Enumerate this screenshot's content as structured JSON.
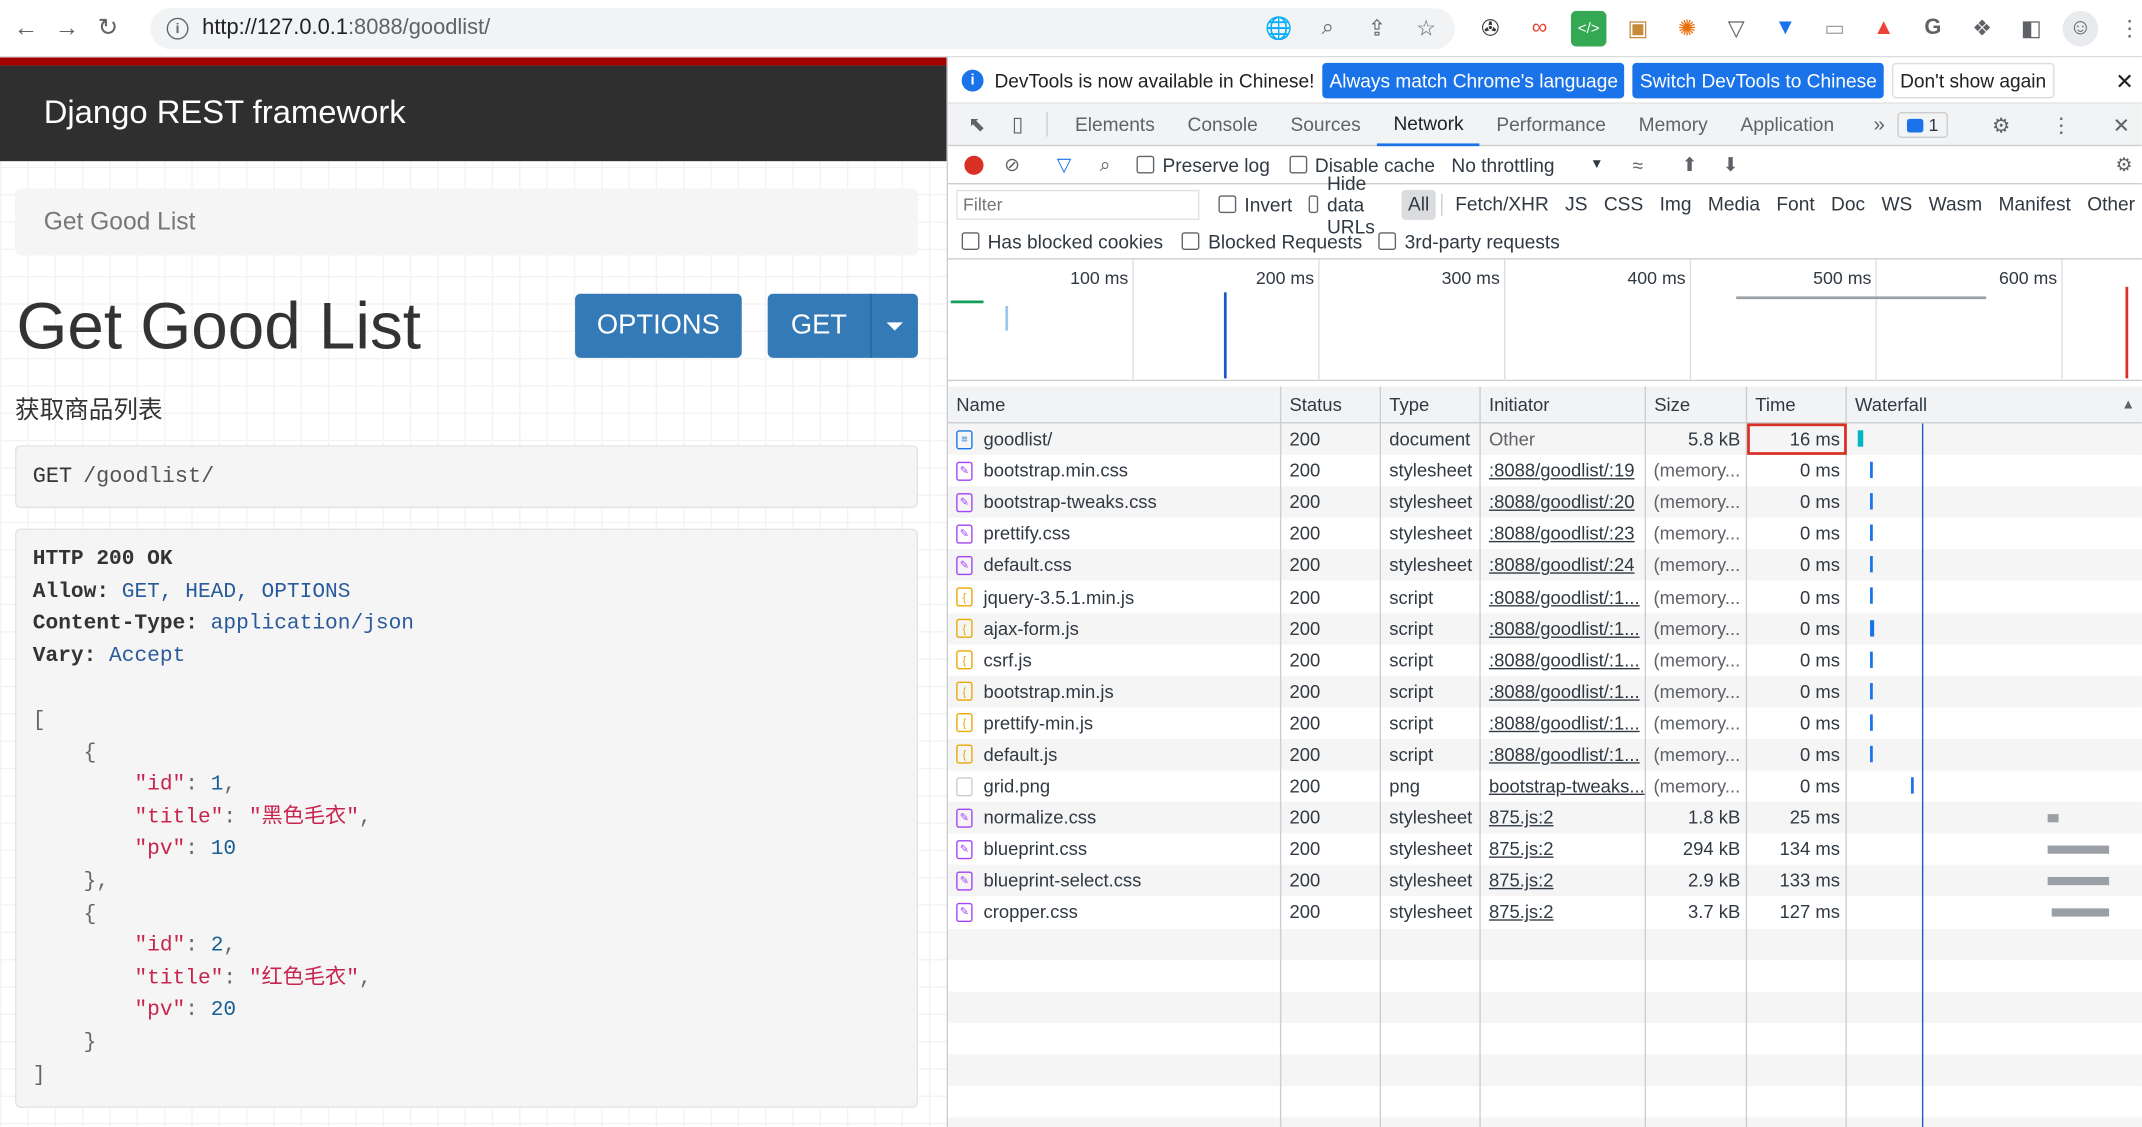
{
  "browser": {
    "url_host": "http://127.0.0.1",
    "url_rest": ":8088/goodlist/"
  },
  "page": {
    "brand": "Django REST framework",
    "breadcrumb": "Get Good List",
    "title": "Get Good List",
    "options_label": "OPTIONS",
    "get_label": "GET",
    "description": "获取商品列表",
    "request_method": "GET",
    "request_path": "/goodlist/",
    "response": {
      "status_line": "HTTP 200 OK",
      "allow_key": "Allow:",
      "allow_val": "GET, HEAD, OPTIONS",
      "ctype_key": "Content-Type:",
      "ctype_val": "application/json",
      "vary_key": "Vary:",
      "vary_val": "Accept",
      "items": [
        {
          "id": "1",
          "title": "\"黑色毛衣\"",
          "pv": "10"
        },
        {
          "id": "2",
          "title": "\"红色毛衣\"",
          "pv": "20"
        }
      ]
    }
  },
  "devtools": {
    "info_msg": "DevTools is now available in Chinese!",
    "btn_match": "Always match Chrome's language",
    "btn_switch": "Switch DevTools to Chinese",
    "btn_dont": "Don't show again",
    "tabs": [
      "Elements",
      "Console",
      "Sources",
      "Network",
      "Performance",
      "Memory",
      "Application"
    ],
    "badge_count": "1",
    "preserve_log": "Preserve log",
    "disable_cache": "Disable cache",
    "throttling": "No throttling",
    "filter_placeholder": "Filter",
    "invert": "Invert",
    "hide_data_urls": "Hide data URLs",
    "types": [
      "All",
      "Fetch/XHR",
      "JS",
      "CSS",
      "Img",
      "Media",
      "Font",
      "Doc",
      "WS",
      "Wasm",
      "Manifest",
      "Other"
    ],
    "blocked_cookies": "Has blocked cookies",
    "blocked_requests": "Blocked Requests",
    "third_party": "3rd-party requests",
    "ticks": [
      "100 ms",
      "200 ms",
      "300 ms",
      "400 ms",
      "500 ms",
      "600 ms"
    ],
    "columns": [
      "Name",
      "Status",
      "Type",
      "Initiator",
      "Size",
      "Time",
      "Waterfall"
    ],
    "rows": [
      {
        "name": "goodlist/",
        "status": "200",
        "type": "document",
        "initiator": "Other",
        "size": "5.8 kB",
        "time": "16 ms",
        "kind": "doc"
      },
      {
        "name": "bootstrap.min.css",
        "status": "200",
        "type": "stylesheet",
        "initiator": ":8088/goodlist/:19",
        "size": "(memory...",
        "time": "0 ms",
        "kind": "css"
      },
      {
        "name": "bootstrap-tweaks.css",
        "status": "200",
        "type": "stylesheet",
        "initiator": ":8088/goodlist/:20",
        "size": "(memory...",
        "time": "0 ms",
        "kind": "css"
      },
      {
        "name": "prettify.css",
        "status": "200",
        "type": "stylesheet",
        "initiator": ":8088/goodlist/:23",
        "size": "(memory...",
        "time": "0 ms",
        "kind": "css"
      },
      {
        "name": "default.css",
        "status": "200",
        "type": "stylesheet",
        "initiator": ":8088/goodlist/:24",
        "size": "(memory...",
        "time": "0 ms",
        "kind": "css"
      },
      {
        "name": "jquery-3.5.1.min.js",
        "status": "200",
        "type": "script",
        "initiator": ":8088/goodlist/:1...",
        "size": "(memory...",
        "time": "0 ms",
        "kind": "js"
      },
      {
        "name": "ajax-form.js",
        "status": "200",
        "type": "script",
        "initiator": ":8088/goodlist/:1...",
        "size": "(memory...",
        "time": "0 ms",
        "kind": "js"
      },
      {
        "name": "csrf.js",
        "status": "200",
        "type": "script",
        "initiator": ":8088/goodlist/:1...",
        "size": "(memory...",
        "time": "0 ms",
        "kind": "js"
      },
      {
        "name": "bootstrap.min.js",
        "status": "200",
        "type": "script",
        "initiator": ":8088/goodlist/:1...",
        "size": "(memory...",
        "time": "0 ms",
        "kind": "js"
      },
      {
        "name": "prettify-min.js",
        "status": "200",
        "type": "script",
        "initiator": ":8088/goodlist/:1...",
        "size": "(memory...",
        "time": "0 ms",
        "kind": "js"
      },
      {
        "name": "default.js",
        "status": "200",
        "type": "script",
        "initiator": ":8088/goodlist/:1...",
        "size": "(memory...",
        "time": "0 ms",
        "kind": "js"
      },
      {
        "name": "grid.png",
        "status": "200",
        "type": "png",
        "initiator": "bootstrap-tweaks...",
        "size": "(memory...",
        "time": "0 ms",
        "kind": "img"
      },
      {
        "name": "normalize.css",
        "status": "200",
        "type": "stylesheet",
        "initiator": "875.js:2",
        "size": "1.8 kB",
        "time": "25 ms",
        "kind": "css"
      },
      {
        "name": "blueprint.css",
        "status": "200",
        "type": "stylesheet",
        "initiator": "875.js:2",
        "size": "294 kB",
        "time": "134 ms",
        "kind": "css"
      },
      {
        "name": "blueprint-select.css",
        "status": "200",
        "type": "stylesheet",
        "initiator": "875.js:2",
        "size": "2.9 kB",
        "time": "133 ms",
        "kind": "css"
      },
      {
        "name": "cropper.css",
        "status": "200",
        "type": "stylesheet",
        "initiator": "875.js:2",
        "size": "3.7 kB",
        "time": "127 ms",
        "kind": "css"
      }
    ]
  }
}
